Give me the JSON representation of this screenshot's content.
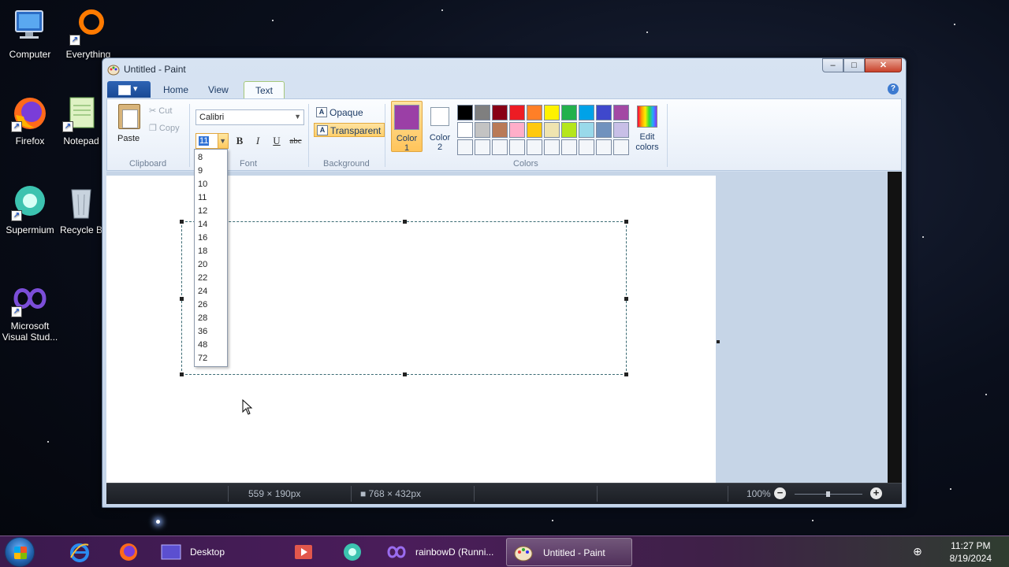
{
  "desktop": {
    "icons": [
      {
        "label": "Computer",
        "icon": "computer-icon"
      },
      {
        "label": "Everything",
        "icon": "everything-icon"
      },
      {
        "label": "Firefox",
        "icon": "firefox-icon"
      },
      {
        "label": "Notepad",
        "icon": "notepad-icon"
      },
      {
        "label": "Supermium",
        "icon": "supermium-icon"
      },
      {
        "label": "Recycle B",
        "icon": "recycle-bin-icon"
      },
      {
        "label": "Microsoft Visual Stud...",
        "icon": "visual-studio-icon"
      }
    ]
  },
  "window": {
    "title": "Untitled - Paint",
    "caption": {
      "minimize": "‒",
      "maximize": "□",
      "close": "✕"
    }
  },
  "ribbon": {
    "tabs": [
      {
        "label": "Home",
        "active": false
      },
      {
        "label": "View",
        "active": false
      },
      {
        "label": "Text",
        "active": true
      }
    ],
    "clipboard": {
      "paste": "Paste",
      "cut": "Cut",
      "copy": "Copy",
      "group": "Clipboard"
    },
    "font": {
      "family": "Calibri",
      "size": "11",
      "bold": "B",
      "italic": "I",
      "underline": "U",
      "strike": "abc",
      "group": "Font"
    },
    "background": {
      "opaque": "Opaque",
      "transparent": "Transparent",
      "selected": "transparent",
      "group": "Background"
    },
    "colors": {
      "color1_label": "Color",
      "color1_num": "1",
      "color2_label": "Color",
      "color2_num": "2",
      "color1": "#9b3fa6",
      "color2": "#ffffff",
      "edit_label": "Edit",
      "edit_label2": "colors",
      "group": "Colors",
      "palette_row1": [
        "#000000",
        "#7f7f7f",
        "#880015",
        "#ed1c24",
        "#ff7f27",
        "#fff200",
        "#22b14c",
        "#00a2e8",
        "#3f48cc",
        "#a349a4"
      ],
      "palette_row2": [
        "#ffffff",
        "#c3c3c3",
        "#b97a57",
        "#ffaec9",
        "#ffc90e",
        "#efe4b0",
        "#b5e61d",
        "#99d9ea",
        "#7092be",
        "#c8bfe7"
      ],
      "palette_row3": [
        "",
        "",
        "",
        "",
        "",
        "",
        "",
        "",
        "",
        ""
      ]
    }
  },
  "font_size_options": [
    "8",
    "9",
    "10",
    "11",
    "12",
    "14",
    "16",
    "18",
    "20",
    "22",
    "24",
    "26",
    "28",
    "36",
    "48",
    "72"
  ],
  "status": {
    "selection_size": "559 × 190px",
    "canvas_size": "768 × 432px",
    "zoom": "100%"
  },
  "taskbar": {
    "items": [
      {
        "label": "",
        "icon": "internet-explorer-icon"
      },
      {
        "label": "",
        "icon": "firefox-icon"
      },
      {
        "label": "Desktop",
        "icon": "desktop-icon"
      },
      {
        "label": "",
        "icon": "media-player-icon"
      },
      {
        "label": "",
        "icon": "supermium-icon"
      },
      {
        "label": "rainbowD (Runni...",
        "icon": "visual-studio-icon"
      },
      {
        "label": "Untitled - Paint",
        "icon": "paint-icon"
      }
    ],
    "time": "11:27 PM",
    "date": "8/19/2024"
  }
}
